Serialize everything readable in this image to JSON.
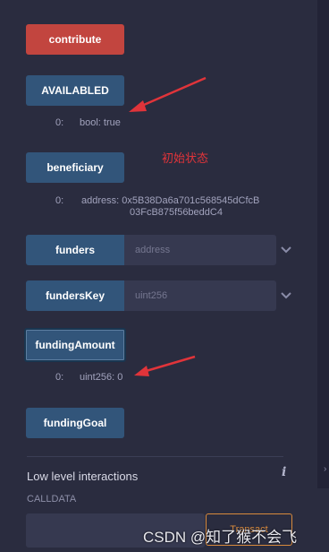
{
  "buttons": {
    "contribute": "contribute",
    "availabled": "AVAILABLED",
    "beneficiary": "beneficiary",
    "funders": "funders",
    "fundersKey": "fundersKey",
    "fundingAmount": "fundingAmount",
    "fundingGoal": "fundingGoal"
  },
  "outputs": {
    "availabled": {
      "index": "0:",
      "value": "bool: true"
    },
    "beneficiary": {
      "index": "0:",
      "line1": "address: 0x5B38Da6a701c568545dCfcB",
      "line2": "03FcB875f56beddC4"
    },
    "fundingAmount": {
      "index": "0:",
      "value": "uint256: 0"
    }
  },
  "inputs": {
    "funders_placeholder": "address",
    "fundersKey_placeholder": "uint256"
  },
  "annotation": {
    "text": "初始状态",
    "color": "#e0343a"
  },
  "low_level": {
    "title": "Low level interactions",
    "calldata_label": "CALLDATA",
    "transact_label": "Transact"
  },
  "watermark": "CSDN @知了猴不会飞",
  "icons": {
    "chevron": "chevron-down-icon",
    "info": "info-icon",
    "arrow": "red-arrow-icon"
  },
  "colors": {
    "background": "#2a2c3f",
    "payable_button": "#c2453f",
    "call_button": "#32557a",
    "transact_border": "#d88a3c"
  }
}
